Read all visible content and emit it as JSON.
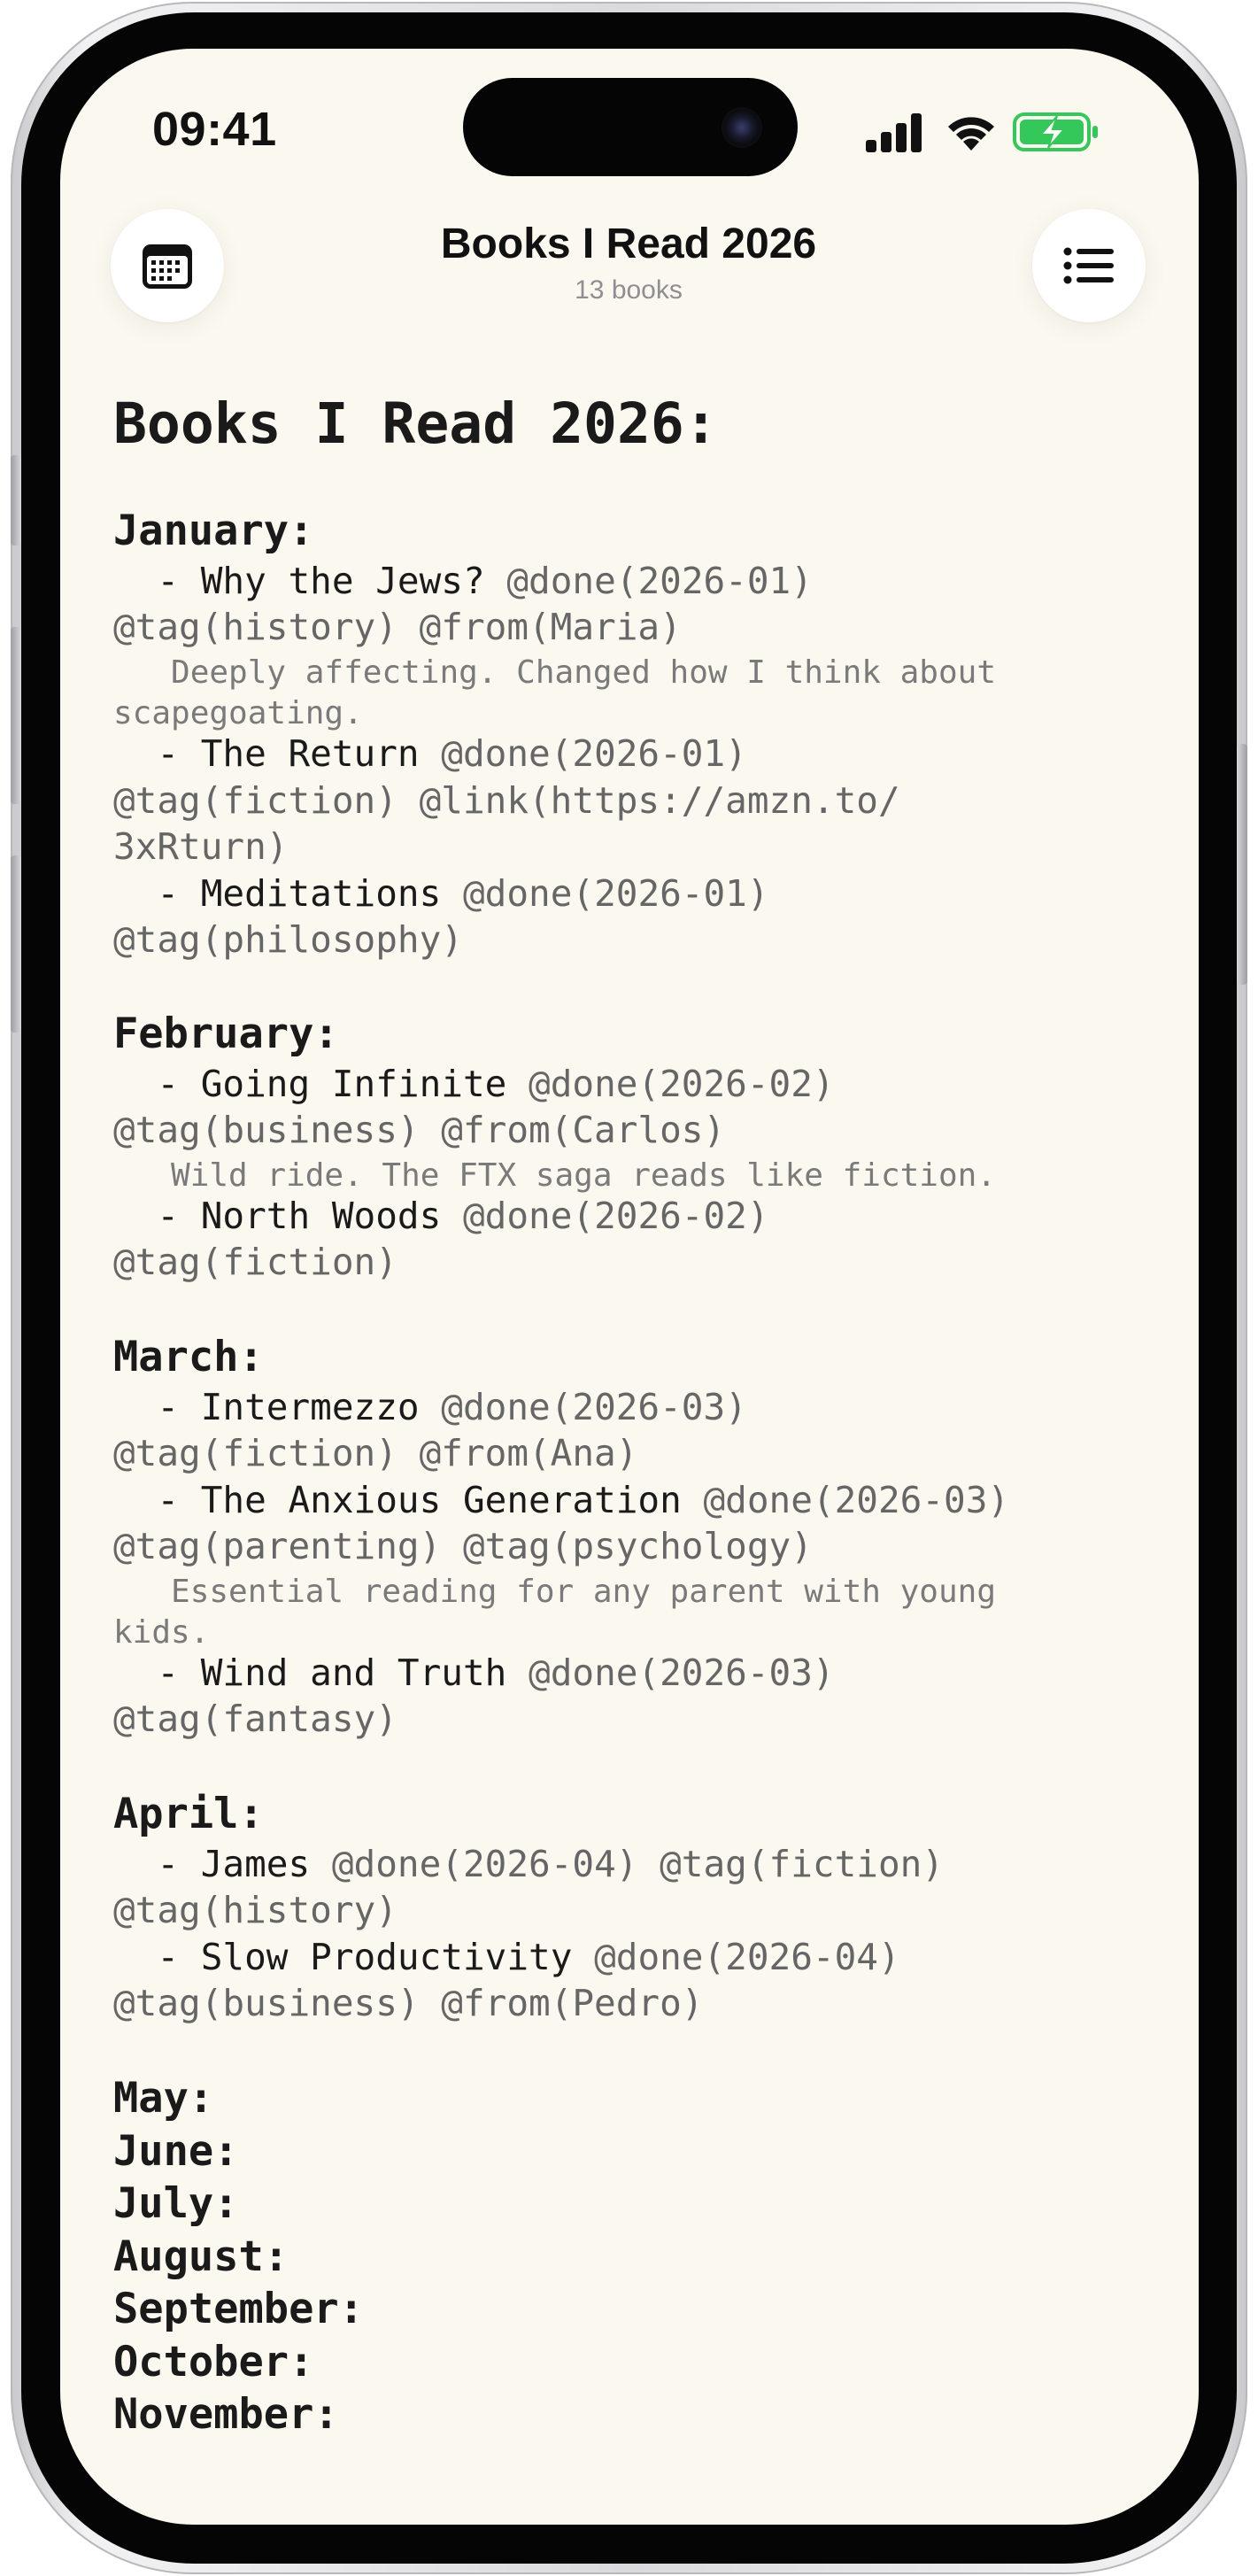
{
  "status_bar": {
    "time": "09:41"
  },
  "nav": {
    "title": "Books I Read 2026",
    "subtitle": "13 books",
    "left_button_icon": "calendar-icon",
    "right_button_icon": "list-icon"
  },
  "document": {
    "title": "Books I Read 2026:",
    "months": {
      "january": "January:",
      "february": "February:",
      "march": "March:",
      "april": "April:",
      "may": "May:",
      "june": "June:",
      "july": "July:",
      "august": "August:",
      "september": "September:",
      "october": "October:",
      "november": "November:"
    },
    "books": [
      {
        "prefix": "  - ",
        "title": "Why the Jews?",
        "meta_line1": " @done(2026-01)",
        "meta_line2": "@tag(history) @from(Maria)",
        "note_line1": "   Deeply affecting. Changed how I think about",
        "note_line2": "scapegoating."
      },
      {
        "prefix": "  - ",
        "title": "The Return",
        "meta_line1": " @done(2026-01)",
        "meta_line2": "@tag(fiction) @link(https://amzn.to/",
        "meta_line3": "3xRturn)"
      },
      {
        "prefix": "  - ",
        "title": "Meditations",
        "meta_line1": " @done(2026-01)",
        "meta_line2": "@tag(philosophy)"
      },
      {
        "prefix": "  - ",
        "title": "Going Infinite",
        "meta_line1": " @done(2026-02)",
        "meta_line2": "@tag(business) @from(Carlos)",
        "note_line1": "   Wild ride. The FTX saga reads like fiction."
      },
      {
        "prefix": "  - ",
        "title": "North Woods",
        "meta_line1": " @done(2026-02)",
        "meta_line2": "@tag(fiction)"
      },
      {
        "prefix": "  - ",
        "title": "Intermezzo",
        "meta_line1": " @done(2026-03)",
        "meta_line2": "@tag(fiction) @from(Ana)"
      },
      {
        "prefix": "  - ",
        "title": "The Anxious Generation",
        "meta_line1": " @done(2026-03)",
        "meta_line2": "@tag(parenting) @tag(psychology)",
        "note_line1": "   Essential reading for any parent with young",
        "note_line2": "kids."
      },
      {
        "prefix": "  - ",
        "title": "Wind and Truth",
        "meta_line1": " @done(2026-03)",
        "meta_line2": "@tag(fantasy)"
      },
      {
        "prefix": "  - ",
        "title": "James",
        "meta_line1": " @done(2026-04) @tag(fiction)",
        "meta_line2": "@tag(history)"
      },
      {
        "prefix": "  - ",
        "title": "Slow Productivity",
        "meta_line1": " @done(2026-04)",
        "meta_line2": "@tag(business) @from(Pedro)"
      }
    ]
  }
}
